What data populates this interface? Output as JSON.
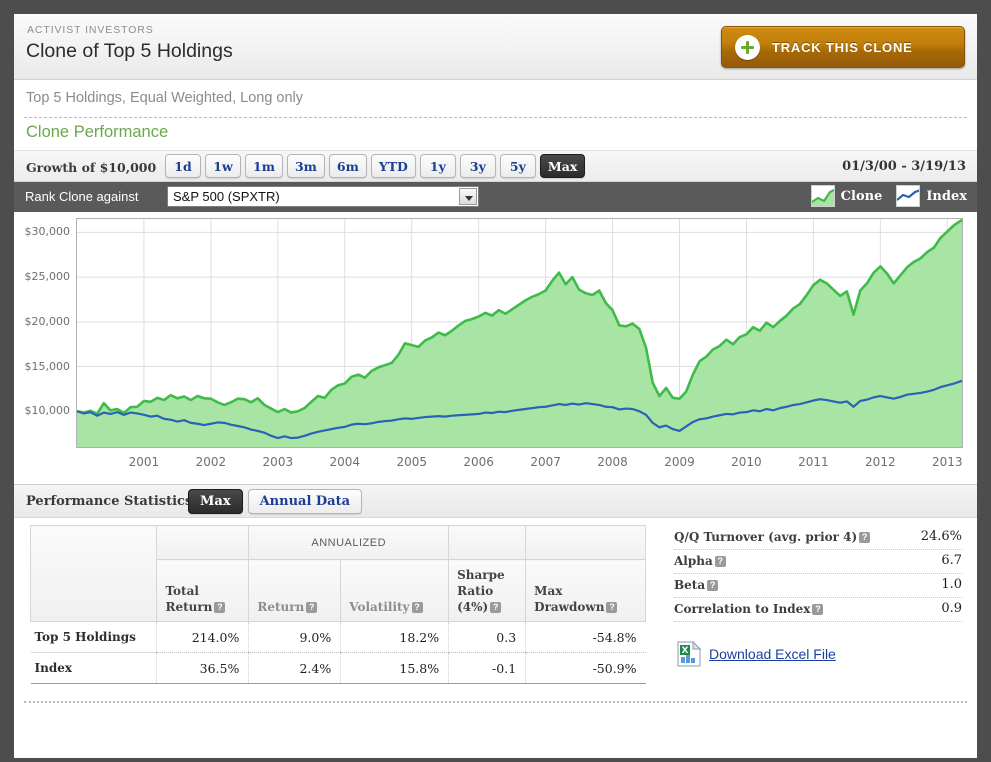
{
  "header": {
    "eyebrow": "ACTIVIST INVESTORS",
    "title": "Clone of Top 5 Holdings",
    "track_button": "TRACK THIS CLONE"
  },
  "subtitle": "Top 5 Holdings, Equal Weighted, Long only",
  "section": {
    "clone_performance": "Clone Performance"
  },
  "range_bar": {
    "growth_label": "Growth of $10,000",
    "buttons": [
      "1d",
      "1w",
      "1m",
      "3m",
      "6m",
      "YTD",
      "1y",
      "3y",
      "5y",
      "Max"
    ],
    "selected": "Max",
    "date_range": "01/3/00 - 3/19/13"
  },
  "rank_bar": {
    "label": "Rank Clone against",
    "selected_option": "S&P 500 (SPXTR)",
    "options": [
      "S&P 500 (SPXTR)"
    ],
    "legend": [
      {
        "name": "Clone",
        "color": "#3fbb4a"
      },
      {
        "name": "Index",
        "color": "#2a63b5"
      }
    ]
  },
  "chart_data": {
    "type": "area",
    "title": "Growth of $10,000",
    "xlabel": "",
    "ylabel": "",
    "ylim": [
      6000,
      31500
    ],
    "yticks": [
      10000,
      15000,
      20000,
      25000,
      30000
    ],
    "ytick_labels": [
      "$10,000",
      "$15,000",
      "$20,000",
      "$25,000",
      "$30,000"
    ],
    "xticks": [
      2001,
      2002,
      2003,
      2004,
      2005,
      2006,
      2007,
      2008,
      2009,
      2010,
      2011,
      2012,
      2013
    ],
    "xtick_labels": [
      "2001",
      "2002",
      "2003",
      "2004",
      "2005",
      "2006",
      "2007",
      "2008",
      "2009",
      "2010",
      "2011",
      "2012",
      "2013"
    ],
    "xlim": [
      2000.0,
      2013.22
    ],
    "grid": true,
    "legend_position": "top-right",
    "series": [
      {
        "name": "Clone",
        "color": "#3fbb4a",
        "fill": "#a8e5a4",
        "x": [
          2000.0,
          2000.1,
          2000.2,
          2000.3,
          2000.4,
          2000.5,
          2000.6,
          2000.7,
          2000.8,
          2000.9,
          2001.0,
          2001.1,
          2001.2,
          2001.3,
          2001.4,
          2001.5,
          2001.6,
          2001.7,
          2001.8,
          2001.9,
          2002.0,
          2002.1,
          2002.2,
          2002.3,
          2002.4,
          2002.5,
          2002.6,
          2002.7,
          2002.8,
          2002.9,
          2003.0,
          2003.1,
          2003.2,
          2003.3,
          2003.4,
          2003.5,
          2003.6,
          2003.7,
          2003.8,
          2003.9,
          2004.0,
          2004.1,
          2004.2,
          2004.3,
          2004.4,
          2004.5,
          2004.6,
          2004.7,
          2004.8,
          2004.9,
          2005.0,
          2005.1,
          2005.2,
          2005.3,
          2005.4,
          2005.5,
          2005.6,
          2005.7,
          2005.8,
          2005.9,
          2006.0,
          2006.1,
          2006.2,
          2006.3,
          2006.4,
          2006.5,
          2006.6,
          2006.7,
          2006.8,
          2006.9,
          2007.0,
          2007.1,
          2007.2,
          2007.3,
          2007.4,
          2007.5,
          2007.6,
          2007.7,
          2007.8,
          2007.9,
          2008.0,
          2008.1,
          2008.2,
          2008.3,
          2008.4,
          2008.5,
          2008.6,
          2008.7,
          2008.8,
          2008.9,
          2009.0,
          2009.1,
          2009.2,
          2009.3,
          2009.4,
          2009.5,
          2009.6,
          2009.7,
          2009.8,
          2009.9,
          2010.0,
          2010.1,
          2010.2,
          2010.3,
          2010.4,
          2010.5,
          2010.6,
          2010.7,
          2010.8,
          2010.9,
          2011.0,
          2011.1,
          2011.2,
          2011.3,
          2011.4,
          2011.5,
          2011.6,
          2011.7,
          2011.8,
          2011.9,
          2012.0,
          2012.1,
          2012.2,
          2012.3,
          2012.4,
          2012.5,
          2012.6,
          2012.7,
          2012.8,
          2012.9,
          2013.0,
          2013.1,
          2013.22
        ],
        "y": [
          10000,
          9850,
          10050,
          9700,
          10900,
          10100,
          10250,
          9800,
          10450,
          10500,
          11150,
          11050,
          11500,
          11250,
          11800,
          11450,
          11650,
          11250,
          11700,
          11450,
          11400,
          11000,
          10700,
          11000,
          11400,
          11350,
          11000,
          11450,
          10700,
          10300,
          9900,
          10250,
          9850,
          10000,
          10350,
          11050,
          11700,
          11500,
          12400,
          12900,
          13100,
          13850,
          14100,
          13750,
          14500,
          14900,
          15150,
          15400,
          16300,
          17600,
          17400,
          17200,
          17900,
          18250,
          18800,
          18500,
          19000,
          19600,
          20100,
          20300,
          20600,
          21000,
          20700,
          21300,
          20900,
          21400,
          21900,
          22400,
          22800,
          23100,
          23500,
          24600,
          25500,
          24200,
          25000,
          23600,
          23200,
          23000,
          23500,
          22100,
          21300,
          19600,
          19500,
          19800,
          19200,
          17100,
          13200,
          11700,
          12600,
          11500,
          11400,
          12200,
          14100,
          15600,
          16100,
          16900,
          17300,
          18000,
          17500,
          18300,
          18600,
          19400,
          19000,
          19900,
          19400,
          20100,
          20700,
          21500,
          22000,
          23000,
          24100,
          24700,
          24300,
          23600,
          22900,
          23400,
          20800,
          23500,
          24300,
          25500,
          26200,
          25400,
          24300,
          25200,
          26100,
          26700,
          27100,
          27800,
          28300,
          29400,
          30100,
          30800,
          31400
        ]
      },
      {
        "name": "Index",
        "color": "#2a63b5",
        "x": [
          2000.0,
          2000.1,
          2000.2,
          2000.3,
          2000.4,
          2000.5,
          2000.6,
          2000.7,
          2000.8,
          2000.9,
          2001.0,
          2001.1,
          2001.2,
          2001.3,
          2001.4,
          2001.5,
          2001.6,
          2001.7,
          2001.8,
          2001.9,
          2002.0,
          2002.1,
          2002.2,
          2002.3,
          2002.4,
          2002.5,
          2002.6,
          2002.7,
          2002.8,
          2002.9,
          2003.0,
          2003.1,
          2003.2,
          2003.3,
          2003.4,
          2003.5,
          2003.6,
          2003.7,
          2003.8,
          2003.9,
          2004.0,
          2004.1,
          2004.2,
          2004.3,
          2004.4,
          2004.5,
          2004.6,
          2004.7,
          2004.8,
          2004.9,
          2005.0,
          2005.1,
          2005.2,
          2005.3,
          2005.4,
          2005.5,
          2005.6,
          2005.7,
          2005.8,
          2005.9,
          2006.0,
          2006.1,
          2006.2,
          2006.3,
          2006.4,
          2006.5,
          2006.6,
          2006.7,
          2006.8,
          2006.9,
          2007.0,
          2007.1,
          2007.2,
          2007.3,
          2007.4,
          2007.5,
          2007.6,
          2007.7,
          2007.8,
          2007.9,
          2008.0,
          2008.1,
          2008.2,
          2008.3,
          2008.4,
          2008.5,
          2008.6,
          2008.7,
          2008.8,
          2008.9,
          2009.0,
          2009.1,
          2009.2,
          2009.3,
          2009.4,
          2009.5,
          2009.6,
          2009.7,
          2009.8,
          2009.9,
          2010.0,
          2010.1,
          2010.2,
          2010.3,
          2010.4,
          2010.5,
          2010.6,
          2010.7,
          2010.8,
          2010.9,
          2011.0,
          2011.1,
          2011.2,
          2011.3,
          2011.4,
          2011.5,
          2011.6,
          2011.7,
          2011.8,
          2011.9,
          2012.0,
          2012.1,
          2012.2,
          2012.3,
          2012.4,
          2012.5,
          2012.6,
          2012.7,
          2012.8,
          2012.9,
          2013.0,
          2013.1,
          2013.22
        ],
        "y": [
          10000,
          9750,
          9900,
          9500,
          9850,
          9700,
          9900,
          9600,
          9850,
          9750,
          9600,
          9400,
          9500,
          9150,
          9050,
          8850,
          9000,
          8700,
          8600,
          8450,
          8600,
          8750,
          8700,
          8500,
          8350,
          8200,
          7950,
          7800,
          7600,
          7250,
          7000,
          7200,
          7000,
          7050,
          7250,
          7500,
          7700,
          7850,
          8000,
          8150,
          8250,
          8500,
          8600,
          8550,
          8650,
          8800,
          8900,
          8950,
          9100,
          9200,
          9150,
          9250,
          9350,
          9400,
          9450,
          9400,
          9500,
          9550,
          9600,
          9650,
          9700,
          9850,
          9800,
          9950,
          9900,
          10050,
          10150,
          10250,
          10350,
          10450,
          10500,
          10650,
          10800,
          10700,
          10850,
          10750,
          10900,
          10800,
          10700,
          10500,
          10450,
          10200,
          10300,
          10250,
          10000,
          9600,
          8700,
          8200,
          8400,
          8000,
          7800,
          8300,
          8800,
          9100,
          9200,
          9400,
          9550,
          9700,
          9650,
          9850,
          9900,
          10100,
          10000,
          10250,
          10100,
          10350,
          10500,
          10700,
          10800,
          11000,
          11200,
          11350,
          11250,
          11100,
          10950,
          11100,
          10500,
          11150,
          11300,
          11550,
          11700,
          11550,
          11400,
          11600,
          11850,
          11950,
          12050,
          12200,
          12400,
          12700,
          12900,
          13100,
          13400
        ]
      }
    ]
  },
  "performance_statistics": {
    "title": "Performance Statistics",
    "tabs": [
      "Max",
      "Annual Data"
    ],
    "selected_tab": "Max",
    "group_header": "ANNUALIZED",
    "columns": [
      {
        "label": "Total\nReturn",
        "line1": "Total",
        "line2": "Return",
        "help": "?",
        "muted": false
      },
      {
        "label": "Return",
        "line1": "",
        "line2": "Return",
        "help": "?",
        "muted": true
      },
      {
        "label": "Volatility",
        "line1": "",
        "line2": "Volatility",
        "help": "?",
        "muted": true
      },
      {
        "label": "Sharpe Ratio (4%)",
        "line1": "Sharpe",
        "line2": "Ratio",
        "line3": "(4%)",
        "help": "?",
        "muted": false
      },
      {
        "label": "Max Drawdown",
        "line1": "Max",
        "line2": "Drawdown",
        "help": "?",
        "muted": false
      }
    ],
    "rows": [
      {
        "name": "Top 5 Holdings",
        "total_return": "214.0%",
        "ann_return": "9.0%",
        "volatility": "18.2%",
        "sharpe": "0.3",
        "max_drawdown": "-54.8%"
      },
      {
        "name": "Index",
        "total_return": "36.5%",
        "ann_return": "2.4%",
        "volatility": "15.8%",
        "sharpe": "-0.1",
        "max_drawdown": "-50.9%"
      }
    ]
  },
  "metrics": [
    {
      "label": "Q/Q Turnover (avg. prior 4)",
      "help": "?",
      "value": "24.6%"
    },
    {
      "label": "Alpha",
      "help": "?",
      "value": "6.7"
    },
    {
      "label": "Beta",
      "help": "?",
      "value": "1.0"
    },
    {
      "label": "Correlation to Index",
      "help": "?",
      "value": "0.9"
    }
  ],
  "download": {
    "link_text": "Download Excel File"
  }
}
